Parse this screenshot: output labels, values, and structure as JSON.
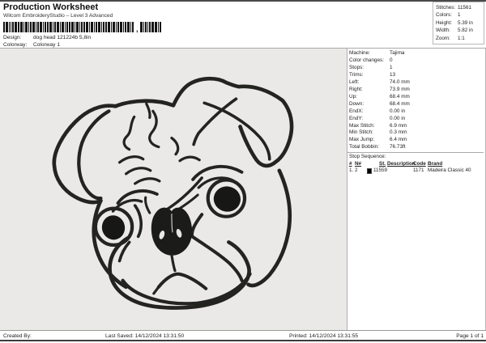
{
  "header": {
    "title": "Production Worksheet",
    "subtitle": "Wilcom EmbroideryStudio – Level 3 Advanced",
    "design_label": "Design:",
    "design_value": "dog head 121224b 5,8in",
    "colorway_label": "Colorway:",
    "colorway_value": "Colorway 1",
    "barcode": {
      "groups": [
        "dog head 121224b 5",
        "8in"
      ],
      "separator": ","
    }
  },
  "summary": {
    "rows": [
      {
        "label": "Stitches:",
        "value": "11561"
      },
      {
        "label": "Colors:",
        "value": "1"
      },
      {
        "label": "Height:",
        "value": "5.39 in"
      },
      {
        "label": "Width:",
        "value": "5.82 in"
      },
      {
        "label": "Zoom:",
        "value": "1:1"
      }
    ]
  },
  "details": {
    "rows": [
      {
        "label": "Machine:",
        "value": "Tajima"
      },
      {
        "label": "Color changes:",
        "value": "0"
      },
      {
        "label": "Stops:",
        "value": "1"
      },
      {
        "label": "Trims:",
        "value": "13"
      },
      {
        "label": "Left:",
        "value": "74.0 mm"
      },
      {
        "label": "Right:",
        "value": "73.9 mm"
      },
      {
        "label": "Up:",
        "value": "68.4 mm"
      },
      {
        "label": "Down:",
        "value": "68.4 mm"
      },
      {
        "label": "EndX:",
        "value": "0.00 in"
      },
      {
        "label": "EndY:",
        "value": "0.00 in"
      },
      {
        "label": "Max Stitch:",
        "value": "6.9 mm"
      },
      {
        "label": "Min Stitch:",
        "value": "0.3 mm"
      },
      {
        "label": "Max Jump:",
        "value": "6.4 mm"
      },
      {
        "label": "Total Bobbin:",
        "value": "76.73ft"
      }
    ]
  },
  "stop_sequence": {
    "title": "Stop Sequence:",
    "columns": {
      "num": "#",
      "n": "N#",
      "st": "St.",
      "description": "Description",
      "code": "Code",
      "brand": "Brand"
    },
    "rows": [
      {
        "num": "1.",
        "n": "2",
        "swatch_color": "#000000",
        "st": "11559",
        "description": "",
        "code": "1171",
        "brand": "Madeira Classic 40"
      }
    ]
  },
  "canvas": {
    "design_name": "pug dog head outline embroidery",
    "background": "#eae9e7",
    "stitch_color": "#232320"
  },
  "footer": {
    "created_by": "Created By:",
    "last_saved": "Last Saved: 14/12/2024 13:31:50",
    "printed": "Printed: 14/12/2024 13:31:55",
    "page": "Page 1 of 1"
  }
}
